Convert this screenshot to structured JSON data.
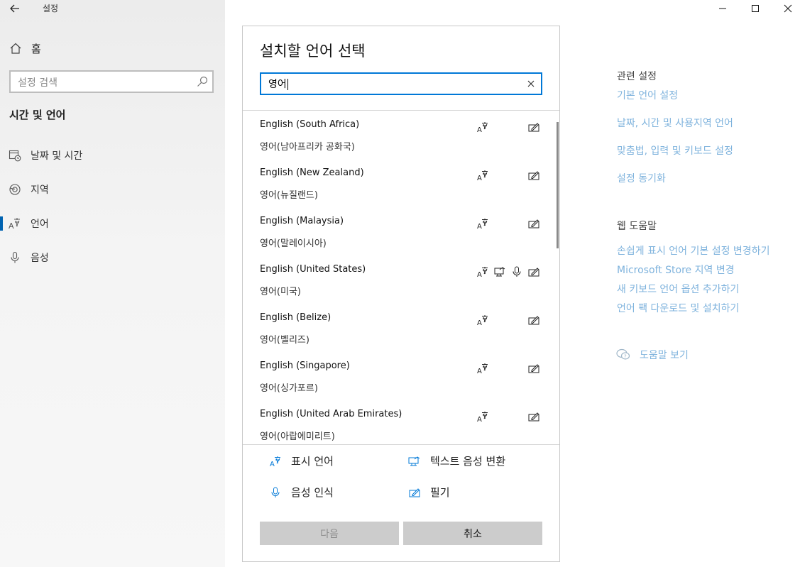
{
  "app": {
    "title": "설정"
  },
  "window_controls": {
    "minimize": "minimize-icon",
    "maximize": "maximize-icon",
    "close": "close-icon"
  },
  "sidebar": {
    "home_label": "홈",
    "search_placeholder": "설정 검색",
    "section_title": "시간 및 언어",
    "items": [
      {
        "label": "날짜 및 시간",
        "icon": "calendar-clock-icon"
      },
      {
        "label": "지역",
        "icon": "globe-icon"
      },
      {
        "label": "언어",
        "icon": "language-icon",
        "active": true
      },
      {
        "label": "음성",
        "icon": "microphone-icon"
      }
    ]
  },
  "related": {
    "settings_heading": "관련 설정",
    "settings_links": [
      "기본 언어 설정",
      "날짜, 시간 및 사용지역 언어",
      "맞춤법, 입력 및 키보드 설정",
      "설정 동기화"
    ],
    "help_heading": "웹 도움말",
    "help_links": [
      "손쉽게 표시 언어 기본 설정 변경하기",
      "Microsoft Store 지역 변경",
      "새 키보드 언어 옵션 추가하기",
      "언어 팩 다운로드 및 설치하기"
    ],
    "help_view": "도움말 보기"
  },
  "dialog": {
    "title": "설치할 언어 선택",
    "search_value": "영어",
    "languages": [
      {
        "name": "English (South Africa)",
        "native": "영어(남아프리카 공화국)",
        "features": [
          "display",
          "handwriting"
        ]
      },
      {
        "name": "English (New Zealand)",
        "native": "영어(뉴질랜드)",
        "features": [
          "display",
          "handwriting"
        ]
      },
      {
        "name": "English (Malaysia)",
        "native": "영어(말레이시아)",
        "features": [
          "display",
          "handwriting"
        ]
      },
      {
        "name": "English (United States)",
        "native": "영어(미국)",
        "features": [
          "display",
          "tts",
          "speech",
          "handwriting"
        ]
      },
      {
        "name": "English (Belize)",
        "native": "영어(벨리즈)",
        "features": [
          "display",
          "handwriting"
        ]
      },
      {
        "name": "English (Singapore)",
        "native": "영어(싱가포르)",
        "features": [
          "display",
          "handwriting"
        ]
      },
      {
        "name": "English (United Arab Emirates)",
        "native": "영어(아랍에미리트)",
        "features": [
          "display",
          "handwriting"
        ]
      }
    ],
    "legend": {
      "display": "표시 언어",
      "tts": "텍스트 음성 변환",
      "speech": "음성 인식",
      "handwriting": "필기"
    },
    "next_label": "다음",
    "cancel_label": "취소"
  },
  "colors": {
    "accent": "#0078d7",
    "link": "#7fb3dd",
    "button": "#cccccc"
  }
}
